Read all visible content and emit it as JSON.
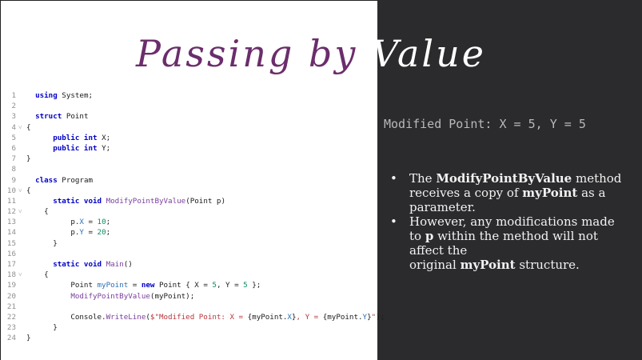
{
  "slide": {
    "title_left": "Passing by",
    "title_right": "Value",
    "output_text": "Modified Point: X = 5, Y = 5",
    "colors": {
      "left_bg": "#ffffff",
      "right_bg": "#2b2a2d",
      "title_accent": "#6b2d6b",
      "keyword": "#0000c8",
      "method": "#7a3e9d",
      "string": "#b6383c",
      "number": "#0d8a62"
    },
    "bullets": [
      {
        "segments": [
          {
            "text": "The ",
            "bold": false
          },
          {
            "text": "ModifyPointByValue",
            "bold": true
          },
          {
            "text": " method receives a copy of ",
            "bold": false
          },
          {
            "text": "myPoint",
            "bold": true
          },
          {
            "text": " as a parameter.",
            "bold": false
          }
        ]
      },
      {
        "segments": [
          {
            "text": "However, any modifications made to ",
            "bold": false
          },
          {
            "text": "p",
            "bold": true
          },
          {
            "text": " within the method will not affect the",
            "bold": false
          },
          {
            "text": "\noriginal ",
            "bold": false
          },
          {
            "text": "myPoint",
            "bold": true
          },
          {
            "text": " structure.",
            "bold": false
          }
        ]
      }
    ]
  },
  "code": [
    {
      "n": "1",
      "fold": false,
      "t": [
        [
          "",
          "  "
        ],
        [
          "kw",
          "using"
        ],
        [
          "",
          " System;"
        ]
      ]
    },
    {
      "n": "2",
      "fold": false,
      "t": []
    },
    {
      "n": "3",
      "fold": false,
      "t": [
        [
          "",
          "  "
        ],
        [
          "kw",
          "struct"
        ],
        [
          "",
          " Point"
        ]
      ]
    },
    {
      "n": "4",
      "fold": true,
      "t": [
        [
          "",
          "{"
        ]
      ]
    },
    {
      "n": "5",
      "fold": false,
      "t": [
        [
          "",
          "      "
        ],
        [
          "kw",
          "public int"
        ],
        [
          "",
          " X;"
        ]
      ]
    },
    {
      "n": "6",
      "fold": false,
      "t": [
        [
          "",
          "      "
        ],
        [
          "kw",
          "public int"
        ],
        [
          "",
          " Y;"
        ]
      ]
    },
    {
      "n": "7",
      "fold": false,
      "t": [
        [
          "",
          "}"
        ]
      ]
    },
    {
      "n": "8",
      "fold": false,
      "t": []
    },
    {
      "n": "9",
      "fold": false,
      "t": [
        [
          "",
          "  "
        ],
        [
          "kw",
          "class"
        ],
        [
          "",
          " Program"
        ]
      ]
    },
    {
      "n": "10",
      "fold": true,
      "t": [
        [
          "",
          "{"
        ]
      ]
    },
    {
      "n": "11",
      "fold": false,
      "t": [
        [
          "",
          "      "
        ],
        [
          "kw",
          "static void"
        ],
        [
          "",
          " "
        ],
        [
          "fn",
          "ModifyPointByValue"
        ],
        [
          "",
          "(Point p)"
        ]
      ]
    },
    {
      "n": "12",
      "fold": true,
      "t": [
        [
          "",
          "    {"
        ]
      ]
    },
    {
      "n": "13",
      "fold": false,
      "t": [
        [
          "",
          "          p."
        ],
        [
          "prop",
          "X"
        ],
        [
          "",
          " = "
        ],
        [
          "num",
          "10"
        ],
        [
          "",
          ";"
        ]
      ]
    },
    {
      "n": "14",
      "fold": false,
      "t": [
        [
          "",
          "          p."
        ],
        [
          "prop",
          "Y"
        ],
        [
          "",
          " = "
        ],
        [
          "num",
          "20"
        ],
        [
          "",
          ";"
        ]
      ]
    },
    {
      "n": "15",
      "fold": false,
      "t": [
        [
          "",
          "      }"
        ]
      ]
    },
    {
      "n": "16",
      "fold": false,
      "t": []
    },
    {
      "n": "17",
      "fold": false,
      "t": [
        [
          "",
          "      "
        ],
        [
          "kw",
          "static void"
        ],
        [
          "",
          " "
        ],
        [
          "fn",
          "Main"
        ],
        [
          "",
          "()"
        ]
      ]
    },
    {
      "n": "18",
      "fold": true,
      "t": [
        [
          "",
          "    {"
        ]
      ]
    },
    {
      "n": "19",
      "fold": false,
      "t": [
        [
          "",
          "          Point "
        ],
        [
          "prop",
          "myPoint"
        ],
        [
          "",
          " = "
        ],
        [
          "kw",
          "new"
        ],
        [
          "",
          " Point { X = "
        ],
        [
          "num",
          "5"
        ],
        [
          "",
          ", Y = "
        ],
        [
          "num",
          "5"
        ],
        [
          "",
          " };"
        ]
      ]
    },
    {
      "n": "20",
      "fold": false,
      "t": [
        [
          "",
          "          "
        ],
        [
          "fn",
          "ModifyPointByValue"
        ],
        [
          "",
          "(myPoint);"
        ]
      ]
    },
    {
      "n": "21",
      "fold": false,
      "t": []
    },
    {
      "n": "22",
      "fold": false,
      "t": [
        [
          "",
          "          Console."
        ],
        [
          "fn",
          "WriteLine"
        ],
        [
          "",
          "("
        ],
        [
          "str",
          "$\"Modified Point: X = "
        ],
        [
          "",
          "{myPoint."
        ],
        [
          "prop",
          "X"
        ],
        [
          "",
          "}"
        ],
        [
          "str",
          ", Y = "
        ],
        [
          "",
          "{myPoint."
        ],
        [
          "prop",
          "Y"
        ],
        [
          "",
          "}"
        ],
        [
          "str",
          "\""
        ],
        [
          "",
          ");"
        ]
      ]
    },
    {
      "n": "23",
      "fold": false,
      "t": [
        [
          "",
          "      }"
        ]
      ]
    },
    {
      "n": "24",
      "fold": false,
      "t": [
        [
          "",
          "}"
        ]
      ]
    }
  ]
}
